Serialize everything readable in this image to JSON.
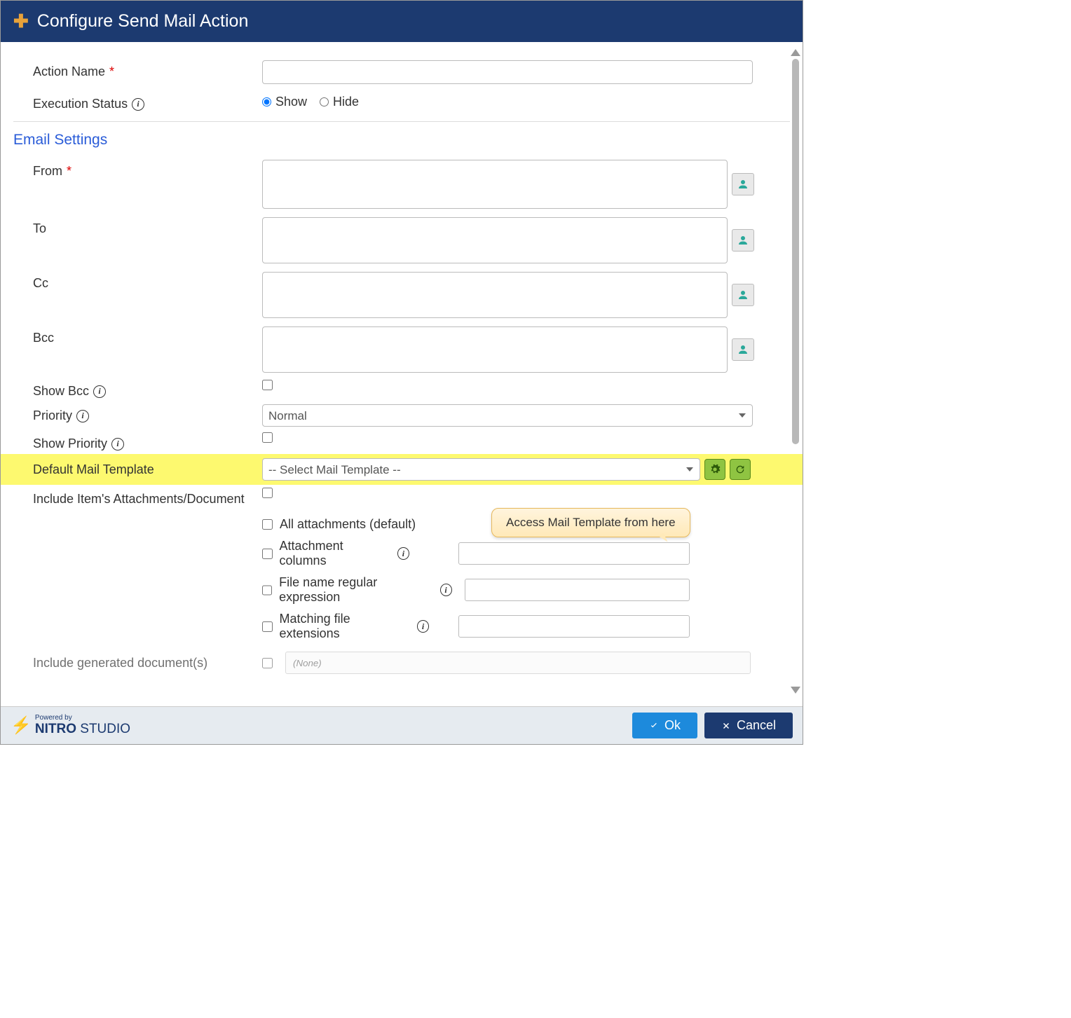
{
  "header": {
    "title": "Configure Send Mail Action"
  },
  "labels": {
    "action_name": "Action Name",
    "execution_status": "Execution Status",
    "show": "Show",
    "hide": "Hide",
    "email_settings": "Email Settings",
    "from": "From",
    "to": "To",
    "cc": "Cc",
    "bcc": "Bcc",
    "show_bcc": "Show Bcc",
    "priority": "Priority",
    "show_priority": "Show Priority",
    "default_mail_template": "Default Mail Template",
    "include_attachments": "Include Item's Attachments/Document",
    "all_attachments": "All attachments (default)",
    "attachment_columns": "Attachment columns",
    "file_regex": "File name regular expression",
    "matching_ext": "Matching file extensions",
    "include_generated": "Include generated document(s)",
    "none_placeholder": "(None)"
  },
  "values": {
    "action_name": "",
    "execution_status": "show",
    "from": "",
    "to": "",
    "cc": "",
    "bcc": "",
    "show_bcc": false,
    "priority_selected": "Normal",
    "show_priority": false,
    "mail_template_selected": "-- Select Mail Template --",
    "include_attachments": false,
    "all_attachments": false,
    "attachment_columns": false,
    "file_regex": false,
    "matching_ext": false,
    "include_generated": false
  },
  "callout": {
    "text": "Access Mail Template from here"
  },
  "footer": {
    "powered_by": "Powered by",
    "logo_main": "NITRO",
    "logo_sub": "STUDIO",
    "ok": "Ok",
    "cancel": "Cancel"
  }
}
